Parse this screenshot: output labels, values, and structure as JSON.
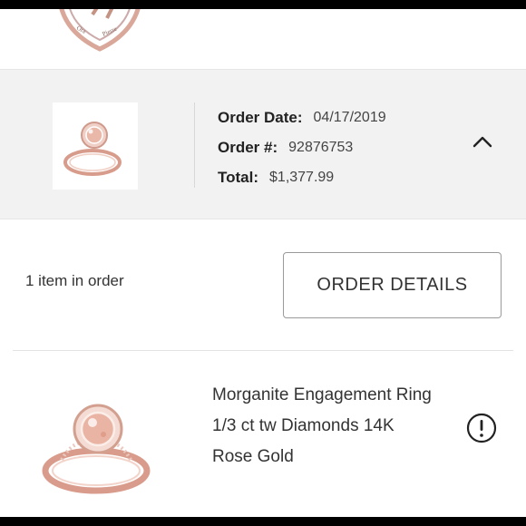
{
  "top_item": {
    "thumbnail_icon": "heart-pendant-icon"
  },
  "order": {
    "date_label": "Order Date:",
    "date_value": "04/17/2019",
    "number_label": "Order #:",
    "number_value": "92876753",
    "total_label": "Total:",
    "total_value": "$1,377.99",
    "thumbnail_icon": "ring-icon",
    "collapse_icon": "chevron-up-icon"
  },
  "items": {
    "count_text": "1 item in order",
    "details_button": "ORDER DETAILS"
  },
  "product": {
    "image_icon": "ring-icon",
    "name_line1": "Morganite Engagement Ring",
    "name_line2": "1/3 ct tw Diamonds 14K",
    "name_line3": "Rose Gold",
    "alert_icon": "alert-circle-icon"
  },
  "colors": {
    "rose_gold": "#d4988a",
    "morganite": "#e8b9ac",
    "card_bg": "#f2f2f2"
  }
}
